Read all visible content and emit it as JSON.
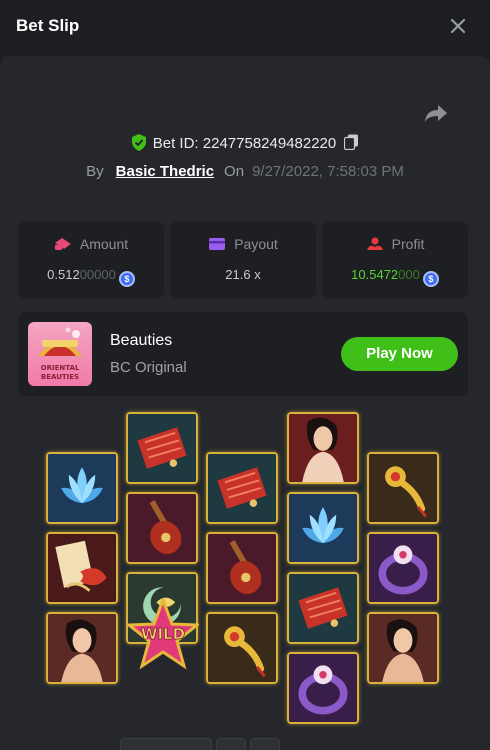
{
  "header": {
    "title": "Bet Slip",
    "close_icon": "close-icon"
  },
  "bet": {
    "id_label": "Bet ID: 2247758249482220",
    "by_label": "By",
    "user": "Basic Thedric",
    "on_label": "On",
    "date": "9/27/2022, 7:58:03 PM"
  },
  "stats": {
    "amount": {
      "label": "Amount",
      "value_main": "0.512",
      "value_dim": "00000",
      "currency_icon": "coin-icon"
    },
    "payout": {
      "label": "Payout",
      "value": "21.6 x"
    },
    "profit": {
      "label": "Profit",
      "value_main": "10.5472",
      "value_dim": "000",
      "currency_icon": "coin-icon"
    }
  },
  "game": {
    "name": "Beauties",
    "provider": "BC Original",
    "play_label": "Play Now",
    "thumb_text_1": "ORIENTAL",
    "thumb_text_2": "BEAUTIES"
  },
  "reels": {
    "wild_label": "WILD",
    "columns": [
      [
        "lotus",
        "scroll-fish",
        "lady"
      ],
      [
        "fan",
        "pipa",
        "moon-flower"
      ],
      [
        "fan",
        "pipa",
        "ruyi"
      ],
      [
        "lady",
        "lotus",
        "fan",
        "bracelet"
      ],
      [
        "ruyi",
        "bracelet",
        "lady"
      ]
    ]
  },
  "colors": {
    "accent_green": "#3fbf18",
    "profit_green": "#5bd431",
    "frame_gold": "#d8b23a",
    "panel": "#25272c"
  }
}
